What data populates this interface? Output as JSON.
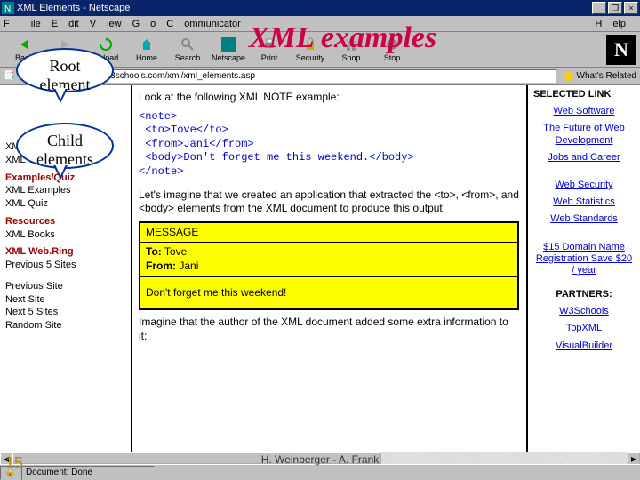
{
  "window": {
    "title": "XML Elements - Netscape"
  },
  "menu": {
    "file": "File",
    "edit": "Edit",
    "view": "View",
    "go": "Go",
    "communicator": "Communicator",
    "help": "Help"
  },
  "toolbar": {
    "back": "Back",
    "forward": "Forward",
    "reload": "Reload",
    "home": "Home",
    "search": "Search",
    "netscape": "Netscape",
    "print": "Print",
    "security": "Security",
    "shop": "Shop",
    "stop": "Stop"
  },
  "banner": "XML examples",
  "location": {
    "label": "Location:",
    "url": "http://www.w3schools.com/xml/xml_elements.asp",
    "related": "What's Related"
  },
  "left": {
    "items_a": [
      "XML Behaviors",
      "XML Technologies"
    ],
    "hdr_b": "Examples/Quiz",
    "items_b": [
      "XML Examples",
      "XML Quiz"
    ],
    "hdr_c": "Resources",
    "items_c": [
      "XML Books"
    ],
    "hdr_d": "XML Web.Ring",
    "items_d": [
      "Previous 5 Sites",
      "Previous Site",
      "Next Site",
      "Next 5 Sites",
      "Random Site"
    ]
  },
  "main": {
    "intro": "Look at the following XML NOTE example:",
    "code": "<note>\n <to>Tove</to>\n <from>Jani</from>\n <body>Don't forget me this weekend.</body>\n</note>",
    "para": "Let's imagine that we created an application that extracted the <to>, <from>, and <body> elements from the XML document to produce this output:",
    "msg_hdr": "MESSAGE",
    "msg_to_label": "To:",
    "msg_to": "Tove",
    "msg_from_label": "From:",
    "msg_from": "Jani",
    "msg_body": "Don't forget me this weekend!",
    "para2": "Imagine that the author of the XML document added some extra information to it:"
  },
  "right": {
    "hdr": "SELECTED LINK",
    "l1": "Web Software",
    "l2": "The Future of Web Development",
    "l3": "Jobs and Career",
    "l4": "Web Security",
    "l5": "Web Statistics",
    "l6": "Web Standards",
    "l7": "$15 Domain Name Registration Save $20 / year",
    "hdr2": "PARTNERS:",
    "l8": "W3Schools",
    "l9": "TopXML",
    "l10": "VisualBuilder"
  },
  "status": {
    "doc": "Document: Done"
  },
  "callouts": {
    "root": "Root element",
    "child": "Child elements"
  },
  "footer": "H. Weinberger -  A. Frank",
  "slide": "15"
}
